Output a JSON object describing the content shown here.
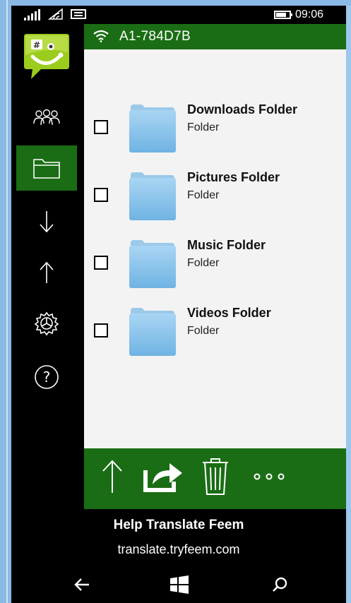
{
  "status_bar": {
    "time": "09:06",
    "icons": [
      "signal-icon",
      "wifi-icon",
      "message-icon",
      "battery-icon"
    ]
  },
  "sidebar": {
    "logo_icon": "feem-logo-icon",
    "items": [
      {
        "icon": "people-icon",
        "active": false
      },
      {
        "icon": "folder-icon",
        "active": true
      },
      {
        "icon": "arrow-down-icon",
        "active": false
      },
      {
        "icon": "arrow-up-icon",
        "active": false
      },
      {
        "icon": "gear-icon",
        "active": false
      },
      {
        "icon": "help-icon",
        "active": false
      }
    ]
  },
  "header": {
    "device_name": "A1-784D7B",
    "icon": "wifi-icon"
  },
  "folders": [
    {
      "title": "Downloads Folder",
      "subtitle": "Folder",
      "checked": false
    },
    {
      "title": "Pictures Folder",
      "subtitle": "Folder",
      "checked": false
    },
    {
      "title": "Music Folder",
      "subtitle": "Folder",
      "checked": false
    },
    {
      "title": "Videos Folder",
      "subtitle": "Folder",
      "checked": false
    }
  ],
  "app_bar": {
    "buttons": [
      "upload-icon",
      "share-icon",
      "trash-icon",
      "more-icon"
    ]
  },
  "help_banner": {
    "title": "Help Translate Feem",
    "url": "translate.tryfeem.com"
  },
  "colors": {
    "accent": "#1a6d14",
    "content_bg": "#f3f3f3",
    "folder_blue": "#7fbde8"
  }
}
